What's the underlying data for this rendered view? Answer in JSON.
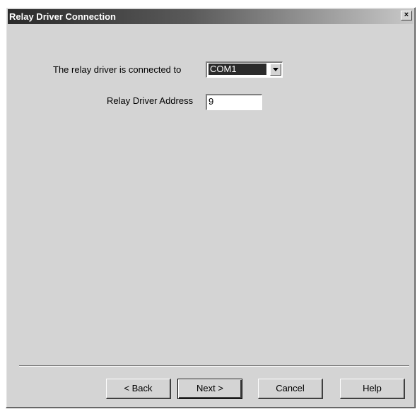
{
  "dialog": {
    "title": "Relay Driver Connection",
    "close_label": "×"
  },
  "form": {
    "connection_label": "The relay driver is connected to",
    "connection_value": "COM1",
    "address_label": "Relay Driver Address",
    "address_value": "9"
  },
  "buttons": {
    "back": "< Back",
    "next": "Next >",
    "cancel": "Cancel",
    "help": "Help"
  }
}
